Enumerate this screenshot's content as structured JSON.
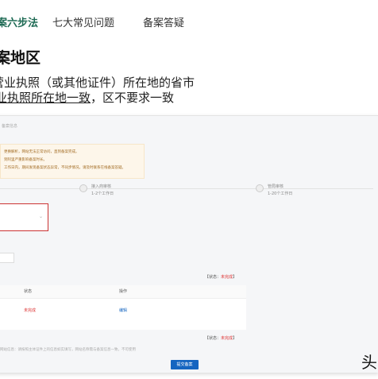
{
  "tabs": [
    {
      "label": "案六步法"
    },
    {
      "label": "七大常见问题"
    },
    {
      "label": "备案答疑"
    }
  ],
  "section": {
    "heading": "案地区",
    "line1": "营业执照（或其他证件）所在地的省市",
    "line2_underlined": "业执照所在地一致",
    "line2_rest": "，区不要求一致"
  },
  "screenshot": {
    "breadcrumb": "备案信息",
    "notice_lines": [
      "更换解析，网站无法正常访问，直到备案完成。",
      "到阿里严重影响备案时长。",
      "工作日内，期间发现备案状态异常，不同步情况，请及时联系在线备案答疑。"
    ],
    "steps": [
      {
        "label": "接入商审核",
        "sub": "1-2个工作日"
      },
      {
        "label": "管局审核",
        "sub": "1-20个工作日"
      }
    ],
    "select_arrow": "⌄",
    "status1": {
      "prefix": "【状态：",
      "value": "未完成",
      "suffix": "】"
    },
    "table": {
      "headers": [
        "状态",
        "操作"
      ],
      "row": {
        "status": "未完成",
        "action": "编辑"
      }
    },
    "status2": {
      "prefix": "【状态：",
      "value": "未完成",
      "suffix": "】"
    },
    "note2": "网站信息：请按照主体证件上的信息如实填写，网站名称需与备案信息一致，不可使用",
    "submit_label": "提交备案"
  },
  "brand_char": "头",
  "colors": {
    "accent": "#1f6b55",
    "danger": "#d33333",
    "primary": "#1565c0"
  }
}
